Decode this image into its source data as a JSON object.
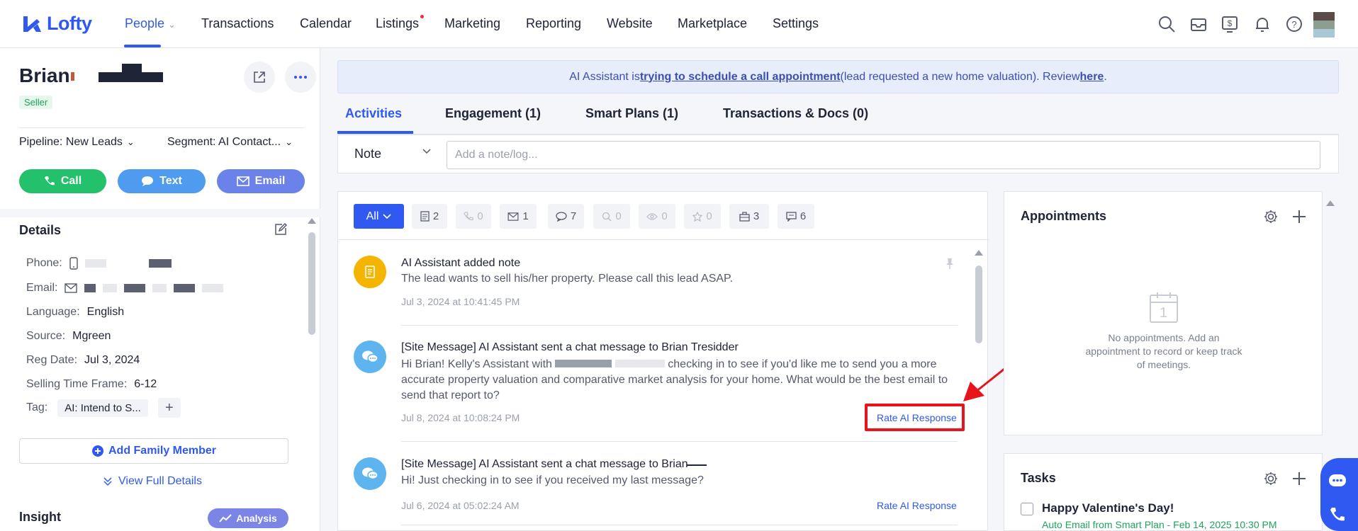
{
  "nav": {
    "brand": "Lofty",
    "items": [
      {
        "label": "People",
        "active": true
      },
      {
        "label": "Transactions"
      },
      {
        "label": "Calendar"
      },
      {
        "label": "Listings"
      },
      {
        "label": "Marketing"
      },
      {
        "label": "Reporting"
      },
      {
        "label": "Website"
      },
      {
        "label": "Marketplace"
      },
      {
        "label": "Settings"
      }
    ],
    "icons": [
      "search-icon",
      "inbox-icon",
      "dollar-icon",
      "bell-icon",
      "help-icon"
    ],
    "accent": "#2f59f0"
  },
  "lead": {
    "first_name": "Brian",
    "badge": "Seller",
    "pipeline": "Pipeline: New Leads",
    "segment": "Segment: AI Contact...",
    "actions": {
      "call": "Call",
      "text": "Text",
      "email": "Email"
    },
    "action_colors": {
      "call": "#23c16b",
      "text": "#4f9bf0",
      "email": "#6a82ea"
    }
  },
  "details": {
    "title": "Details",
    "phone_label": "Phone:",
    "email_label": "Email:",
    "language_label": "Language:",
    "language": "English",
    "source_label": "Source:",
    "source": "Mgreen",
    "reg_date_label": "Reg Date:",
    "reg_date": "Jul 3, 2024",
    "selling_label": "Selling Time Frame:",
    "selling": "6-12",
    "tag_label": "Tag:",
    "tag": "AI: Intend to S...",
    "add_family": "Add Family Member",
    "view_full": "View Full Details",
    "insight": "Insight",
    "analysis": "Analysis"
  },
  "banner": {
    "prefix": "AI Assistant is ",
    "link": "trying to schedule a call appointment",
    "middle": "(lead requested a new home valuation). Review ",
    "here": "here",
    "suffix": "."
  },
  "tabs": [
    "Activities",
    "Engagement (1)",
    "Smart Plans (1)",
    "Transactions & Docs (0)"
  ],
  "note": {
    "type": "Note",
    "placeholder": "Add a note/log..."
  },
  "filters": {
    "all": "All",
    "chips": [
      {
        "icon": "document-icon",
        "count": "2"
      },
      {
        "icon": "phone-icon",
        "count": "0"
      },
      {
        "icon": "mail-icon",
        "count": "1"
      },
      {
        "icon": "chat-icon",
        "count": "7"
      },
      {
        "icon": "search-icon",
        "count": "0"
      },
      {
        "icon": "eye-icon",
        "count": "0"
      },
      {
        "icon": "star-icon",
        "count": "0"
      },
      {
        "icon": "briefcase-icon",
        "count": "3"
      },
      {
        "icon": "message-icon",
        "count": "6"
      }
    ]
  },
  "activities": [
    {
      "title": "AI Assistant added note",
      "body": "The lead wants to sell his/her property. Please call this lead ASAP.",
      "time": "Jul 3, 2024 at 10:41:45 PM"
    },
    {
      "title": "[Site Message] AI Assistant sent a chat message to Brian Tresidder",
      "body_a": "Hi Brian! Kelly's Assistant with",
      "body_b": "checking in to see if you'd like me to send you a more accurate property valuation and comparative market analysis for your home. What would be the best email to send that report to?",
      "time": "Jul 8, 2024 at 10:08:24 PM",
      "rate": "Rate AI Response"
    },
    {
      "title": "[Site Message] AI Assistant sent a chat message to Brian",
      "body": "Hi! Just checking in to see if you received my last message?",
      "time": "Jul 6, 2024 at 05:02:24 AM",
      "rate": "Rate AI Response"
    }
  ],
  "appointments": {
    "title": "Appointments",
    "empty": "No appointments. Add an appointment to record or keep track of meetings.",
    "calendar_day": "1"
  },
  "tasks": {
    "title": "Tasks",
    "item": "Happy Valentine's Day!",
    "sub": "Auto Email from Smart Plan - Feb 14, 2025 10:30 PM"
  },
  "annotation_color": "#e8141c"
}
